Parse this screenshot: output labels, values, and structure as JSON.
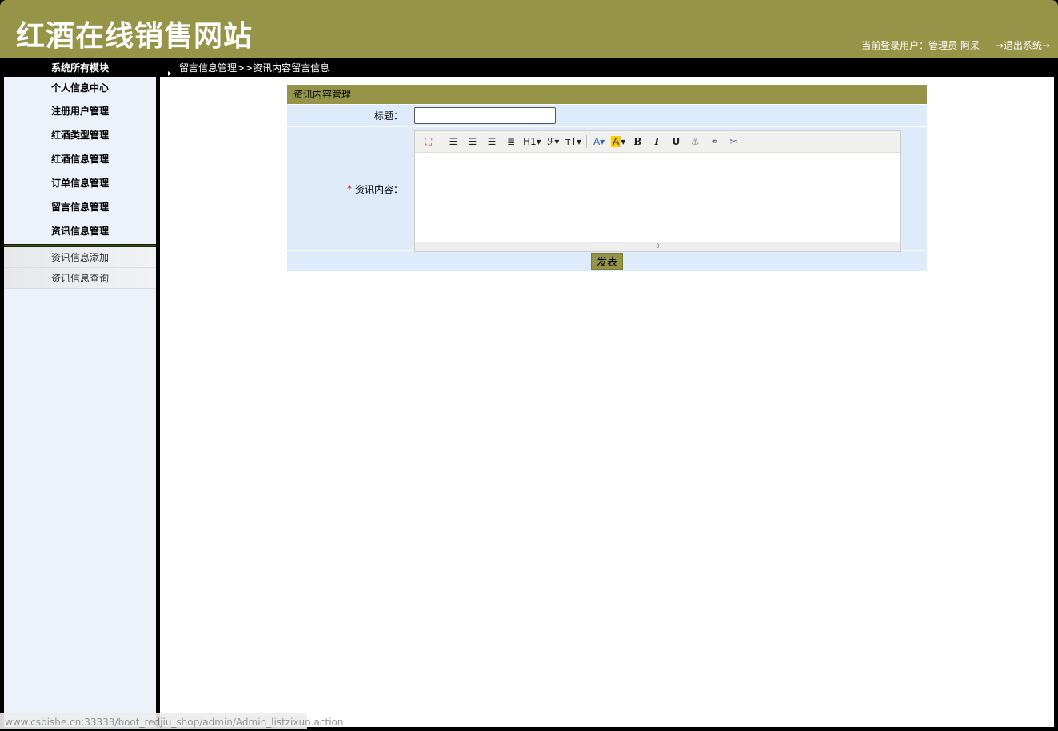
{
  "header": {
    "site_title": "红酒在线销售网站",
    "current_user": "当前登录用户：管理员 阿呆",
    "logout": "→退出系统→"
  },
  "bar": {
    "module_title": "系统所有模块",
    "breadcrumb": "留言信息管理>>资讯内容留言信息"
  },
  "sidebar": {
    "items": [
      {
        "label": "个人信息中心"
      },
      {
        "label": "注册用户管理"
      },
      {
        "label": "红酒类型管理"
      },
      {
        "label": "红酒信息管理"
      },
      {
        "label": "订单信息管理"
      },
      {
        "label": "留言信息管理"
      },
      {
        "label": "资讯信息管理"
      }
    ],
    "sub_items": [
      {
        "label": "资讯信息添加"
      },
      {
        "label": "资讯信息查询"
      }
    ]
  },
  "form": {
    "heading": "资讯内容管理",
    "title_label": "标题：",
    "title_value": "",
    "content_required": "*",
    "content_label": "资讯内容：",
    "submit": "发表",
    "toolbar": {
      "heading": "H1",
      "font": "ℱ",
      "size": "тT",
      "color": "A",
      "bg": "A",
      "bold": "B",
      "italic": "I",
      "underline": "U"
    }
  },
  "status_url": "www.csbishe.cn:33333/boot_redjiu_shop/admin/Admin_listzixun.action"
}
